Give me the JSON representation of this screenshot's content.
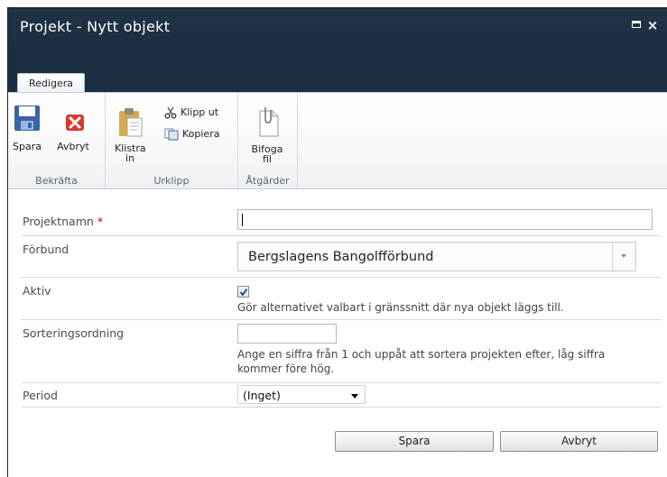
{
  "window": {
    "title": "Projekt - Nytt objekt",
    "maximize_icon": "maximize-icon",
    "close_glyph": "×"
  },
  "ribbon": {
    "tab_label": "Redigera",
    "groups": {
      "bekrafta": {
        "label": "Bekräfta",
        "save_label": "Spara",
        "cancel_label": "Avbryt"
      },
      "urklipp": {
        "label": "Urklipp",
        "paste_label_1": "Klistra",
        "paste_label_2": "in",
        "cut_label": "Klipp ut",
        "copy_label": "Kopiera"
      },
      "atgarder": {
        "label": "Åtgärder",
        "attach_label_1": "Bifoga",
        "attach_label_2": "fil"
      }
    }
  },
  "form": {
    "projektnamn": {
      "label": "Projektnamn",
      "required_marker": "*",
      "value": ""
    },
    "forbund": {
      "label": "Förbund",
      "selected": "Bergslagens Bangolfförbund"
    },
    "aktiv": {
      "label": "Aktiv",
      "checked": true,
      "hint": "Gör alternativet valbart i gränssnitt där nya objekt läggs till."
    },
    "sorteringsordning": {
      "label": "Sorteringsordning",
      "value": "",
      "hint_line1": "Ange en siffra från 1 och uppåt att sortera projekten efter, låg siffra",
      "hint_line2": "kommer före hög."
    },
    "period": {
      "label": "Period",
      "selected": "(Inget)"
    }
  },
  "actions": {
    "save_label": "Spara",
    "cancel_label": "Avbryt"
  },
  "colors": {
    "titlebar": "#1b2d3f",
    "required": "#bf0000",
    "save_icon": "#3a63a8",
    "cancel_icon": "#d93a2b"
  }
}
